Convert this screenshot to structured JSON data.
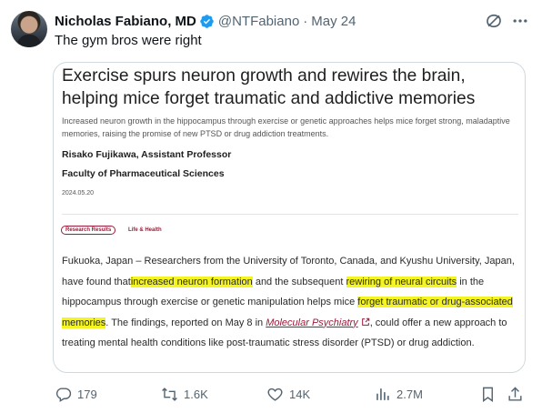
{
  "tweet": {
    "author_name": "Nicholas Fabiano, MD",
    "handle": "@NTFabiano",
    "separator": "·",
    "date": "May 24",
    "text": "The gym bros were right"
  },
  "article": {
    "title": "Exercise spurs neuron growth and rewires the brain, helping mice forget traumatic and addictive memories",
    "subtitle": "Increased neuron growth in the hippocampus through exercise or genetic approaches helps mice forget strong, maladaptive memories, raising the promise of new PTSD or drug addiction treatments.",
    "author": "Risako Fujikawa, Assistant Professor",
    "faculty": "Faculty of Pharmaceutical Sciences",
    "date": "2024.05.20",
    "tags": [
      "Research Results",
      "Life & Health"
    ],
    "body": {
      "p1": "Fukuoka, Japan – Researchers from the University of Toronto, Canada, and Kyushu University, Japan, have found that",
      "hl1": "increased neuron formation",
      "p2": " and the subsequent ",
      "hl2": "rewiring of neural circuits",
      "p3": " in the hippocampus through exercise or genetic manipulation helps mice ",
      "hl3": "forget traumatic or drug-associated memories",
      "p4": ". The findings, reported on May 8 in ",
      "journal": "Molecular Psychiatry",
      "p5": ", could offer a new approach to treating mental health conditions like post-traumatic stress disorder (PTSD) or drug addiction."
    },
    "highlight_color": "#f4f520",
    "accent_color": "#9b1c3a"
  },
  "actions": {
    "replies": "179",
    "retweets": "1.6K",
    "likes": "14K",
    "views": "2.7M"
  },
  "icons": [
    "verified-badge-icon",
    "grok-icon",
    "more-icon",
    "reply-icon",
    "retweet-icon",
    "like-icon",
    "views-icon",
    "bookmark-icon",
    "share-icon",
    "external-link-icon"
  ],
  "colors": {
    "verified": "#1d9bf0",
    "secondary_text": "#536471",
    "border": "#cfd9de"
  }
}
